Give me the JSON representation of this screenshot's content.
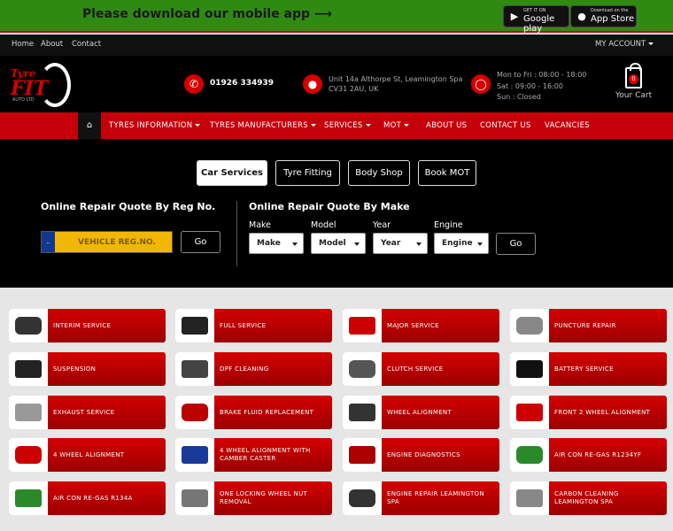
{
  "banner": {
    "message": "Please download our mobile app ⟶",
    "google_play": {
      "small": "GET IT ON",
      "big": "Google play"
    },
    "app_store": {
      "small": "Download on the",
      "big": "App Store"
    }
  },
  "topnav": {
    "home": "Home",
    "about": "About",
    "contact": "Contact",
    "account": "MY ACCOUNT"
  },
  "logo": {
    "line1": "Tyre",
    "line2": "FIT",
    "line3": "AUTO LTD"
  },
  "contact": {
    "phone": "01926 334939",
    "address_line1": "Unit 14a Althorpe St, Leamington Spa",
    "address_line2": "CV31 2AU, UK",
    "hours_line1": "Mon to Fri : 08:00 - 18:00",
    "hours_line2": "Sat : 09:00 - 16:00",
    "hours_line3": "Sun : Closed"
  },
  "cart": {
    "count": "0",
    "label": "Your Cart"
  },
  "mainnav": {
    "home_icon": "home-icon",
    "items": [
      "TYRES INFORMATION",
      "TYRES MANUFACTURERS",
      "SERVICES",
      "MOT",
      "ABOUT US",
      "CONTACT US",
      "VACANCIES"
    ]
  },
  "quote": {
    "tabs": [
      "Car Services",
      "Tyre Fitting",
      "Body Shop",
      "Book MOT"
    ],
    "by_reg_heading": "Online Repair Quote By Reg No.",
    "reg_placeholder": "VEHICLE REG.NO.",
    "reg_badge": "..",
    "go": "Go",
    "by_make_heading": "Online Repair Quote By Make",
    "fields": {
      "make": {
        "label": "Make",
        "value": "Make"
      },
      "model": {
        "label": "Model",
        "value": "Model"
      },
      "year": {
        "label": "Year",
        "value": "Year"
      },
      "engine": {
        "label": "Engine",
        "value": "Engine"
      }
    }
  },
  "services": [
    "INTERIM SERVICE",
    "FULL SERVICE",
    "MAJOR SERVICE",
    "PUNCTURE REPAIR",
    "SUSPENSION",
    "DPF CLEANING",
    "CLUTCH SERVICE",
    "BATTERY SERVICE",
    "EXHAUST SERVICE",
    "BRAKE FLUID REPLACEMENT",
    "WHEEL ALIGNMENT",
    "FRONT 2 WHEEL ALIGNMENT",
    "4 WHEEL ALIGNMENT",
    "4 WHEEL ALIGNMENT WITH CAMBER CASTER",
    "ENGINE DIAGNOSTICS",
    "AIR CON RE-GAS R1234YF",
    "AIR CON RE-GAS R134A",
    "ONE LOCKING WHEEL NUT REMOVAL",
    "ENGINE REPAIR LEAMINGTON SPA",
    "CARBON CLEANING LEAMINGTON SPA"
  ],
  "colors": {
    "banner_green": "#2f8a12",
    "brand_red": "#c5000b",
    "reg_yellow": "#f2b705"
  }
}
